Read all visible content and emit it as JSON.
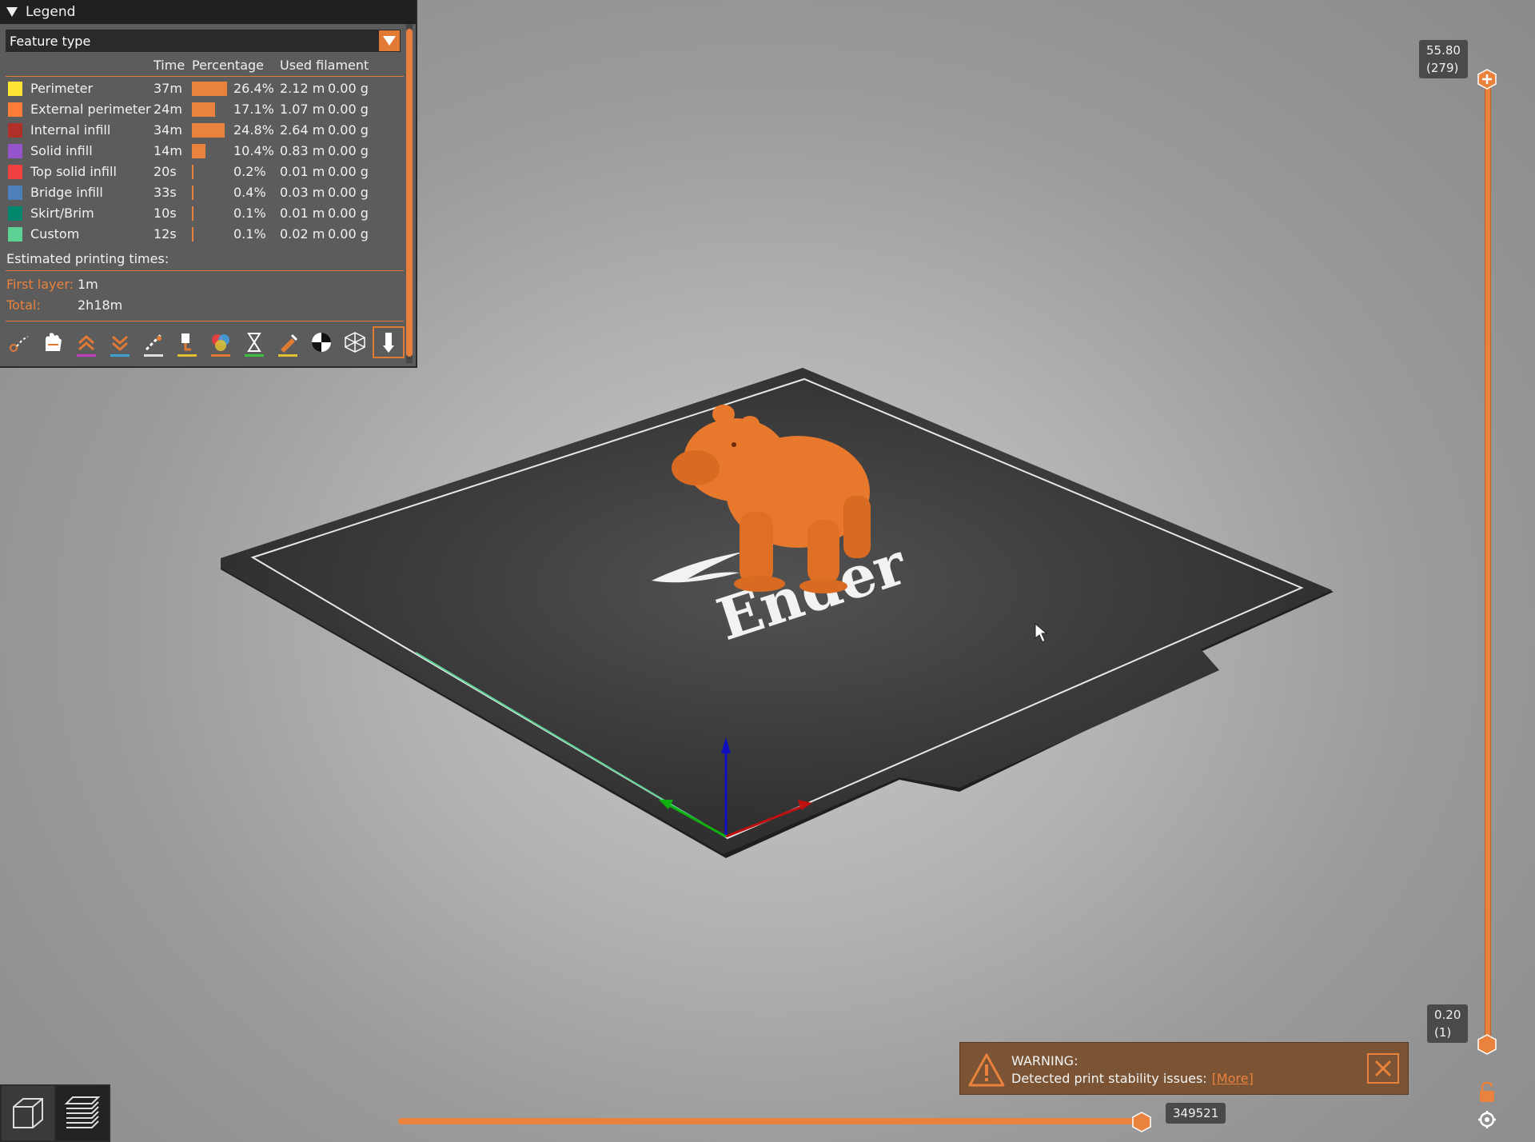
{
  "legend": {
    "title": "Legend",
    "view_type": "Feature type",
    "columns": {
      "time": "Time",
      "percentage": "Percentage",
      "used_filament": "Used filament"
    },
    "rows": [
      {
        "name": "Perimeter",
        "color": "#ffe335",
        "time": "37m",
        "percent": 26.4,
        "percent_label": "26.4%",
        "length": "2.12 m",
        "weight": "0.00 g"
      },
      {
        "name": "External perimeter",
        "color": "#ff7d38",
        "time": "24m",
        "percent": 17.1,
        "percent_label": "17.1%",
        "length": "1.07 m",
        "weight": "0.00 g"
      },
      {
        "name": "Internal infill",
        "color": "#b03029",
        "time": "34m",
        "percent": 24.8,
        "percent_label": "24.8%",
        "length": "2.64 m",
        "weight": "0.00 g"
      },
      {
        "name": "Solid infill",
        "color": "#9654cc",
        "time": "14m",
        "percent": 10.4,
        "percent_label": "10.4%",
        "length": "0.83 m",
        "weight": "0.00 g"
      },
      {
        "name": "Top solid infill",
        "color": "#f04040",
        "time": "20s",
        "percent": 0.2,
        "percent_label": "0.2%",
        "length": "0.01 m",
        "weight": "0.00 g"
      },
      {
        "name": "Bridge infill",
        "color": "#4d80ba",
        "time": "33s",
        "percent": 0.4,
        "percent_label": "0.4%",
        "length": "0.03 m",
        "weight": "0.00 g"
      },
      {
        "name": "Skirt/Brim",
        "color": "#00876e",
        "time": "10s",
        "percent": 0.1,
        "percent_label": "0.1%",
        "length": "0.01 m",
        "weight": "0.00 g"
      },
      {
        "name": "Custom",
        "color": "#5ed194",
        "time": "12s",
        "percent": 0.1,
        "percent_label": "0.1%",
        "length": "0.02 m",
        "weight": "0.00 g"
      }
    ],
    "estimated_title": "Estimated printing times:",
    "first_layer_label": "First layer:",
    "first_layer_value": "1m",
    "total_label": "Total:",
    "total_value": "2h18m",
    "toolbar": [
      {
        "icon": "travel-icon",
        "underline": ""
      },
      {
        "icon": "wipe-icon",
        "underline": ""
      },
      {
        "icon": "retractions-icon",
        "underline": "#c040c0"
      },
      {
        "icon": "deretractions-icon",
        "underline": "#40a0d0"
      },
      {
        "icon": "seams-icon",
        "underline": "#e0e0e0"
      },
      {
        "icon": "tool-changes-icon",
        "underline": "#e0c030"
      },
      {
        "icon": "color-changes-icon",
        "underline": "#e07a35"
      },
      {
        "icon": "pause-icon",
        "underline": "#40c040"
      },
      {
        "icon": "custom-gcode-icon",
        "underline": "#e0c030"
      },
      {
        "icon": "center-of-gravity-icon",
        "underline": ""
      },
      {
        "icon": "shells-icon",
        "underline": ""
      },
      {
        "icon": "tool-marker-icon",
        "underline": ""
      }
    ]
  },
  "vertical_slider": {
    "top_value": "55.80",
    "top_layer": "(279)",
    "bottom_value": "0.20",
    "bottom_layer": "(1)"
  },
  "horizontal_slider": {
    "value": "349521"
  },
  "warning": {
    "title": "WARNING:",
    "message": "Detected print stability issues:",
    "link": "[More]"
  },
  "bed": {
    "logo_text": "Ender"
  },
  "colors": {
    "accent": "#e9823d",
    "model": "#e8782c"
  }
}
